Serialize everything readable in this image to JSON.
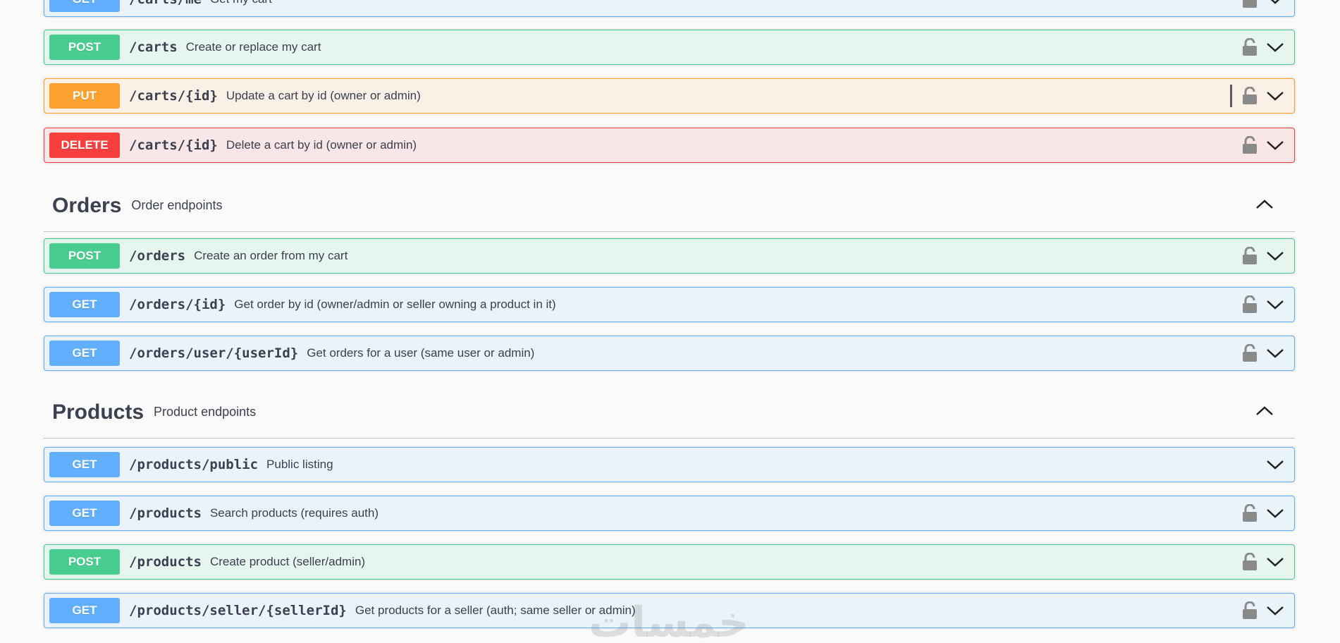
{
  "sections": [
    {
      "type": "tag",
      "name": "Orders",
      "description": "Order endpoints",
      "expanded": true
    },
    {
      "type": "tag",
      "name": "Products",
      "description": "Product endpoints",
      "expanded": true
    }
  ],
  "cart_ops": [
    {
      "method": "GET",
      "path": "/carts/me",
      "summary": "Get my cart",
      "locked": true
    },
    {
      "method": "POST",
      "path": "/carts",
      "summary": "Create or replace my cart",
      "locked": true
    },
    {
      "method": "PUT",
      "path": "/carts/{id}",
      "summary": "Update a cart by id (owner or admin)",
      "locked": true
    },
    {
      "method": "DELETE",
      "path": "/carts/{id}",
      "summary": "Delete a cart by id (owner or admin)",
      "locked": true
    }
  ],
  "order_ops": [
    {
      "method": "POST",
      "path": "/orders",
      "summary": "Create an order from my cart",
      "locked": true
    },
    {
      "method": "GET",
      "path": "/orders/{id}",
      "summary": "Get order by id (owner/admin or seller owning a product in it)",
      "locked": true
    },
    {
      "method": "GET",
      "path": "/orders/user/{userId}",
      "summary": "Get orders for a user (same user or admin)",
      "locked": true
    }
  ],
  "product_ops": [
    {
      "method": "GET",
      "path": "/products/public",
      "summary": "Public listing",
      "locked": false
    },
    {
      "method": "GET",
      "path": "/products",
      "summary": "Search products (requires auth)",
      "locked": true
    },
    {
      "method": "POST",
      "path": "/products",
      "summary": "Create product (seller/admin)",
      "locked": true
    },
    {
      "method": "GET",
      "path": "/products/seller/{sellerId}",
      "summary": "Get products for a seller (auth; same seller or admin)",
      "locked": true
    }
  ],
  "watermark": "خمسات",
  "icons": {
    "lock": "lock-icon",
    "expand": "chevron-down-icon",
    "collapse": "chevron-up-icon"
  },
  "colors": {
    "get": "#61affe",
    "post": "#49cc90",
    "put": "#fca130",
    "delete": "#f93e3e"
  }
}
